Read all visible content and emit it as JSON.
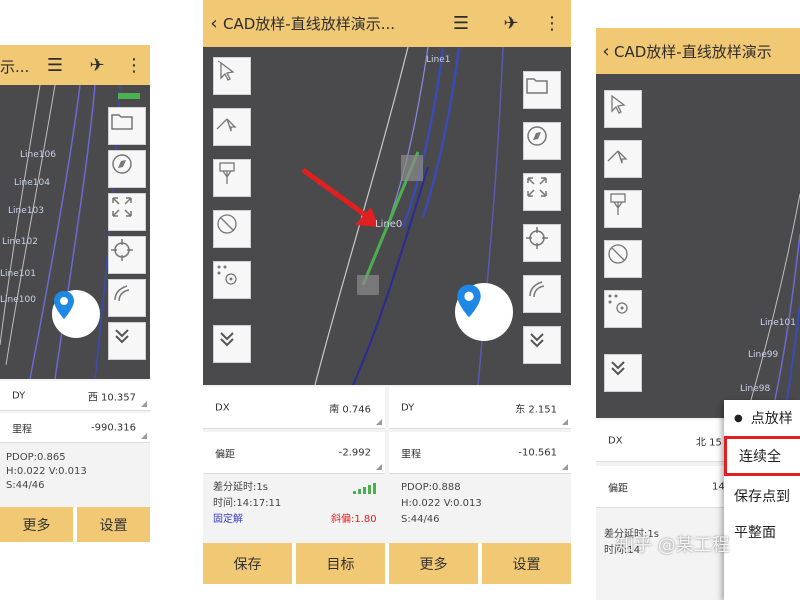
{
  "left": {
    "title": "示...",
    "line_labels": [
      "Line106",
      "Line104",
      "Line103",
      "Line102",
      "Line101",
      "Line100"
    ],
    "fields": [
      {
        "label": "DY",
        "value": "西 10.357"
      },
      {
        "label": "里程",
        "value": "-990.316"
      }
    ],
    "stats": [
      "PDOP:0.865",
      "H:0.022  V:0.013",
      "S:44/46"
    ],
    "buttons": [
      "更多",
      "设置"
    ]
  },
  "center": {
    "title": "CAD放样-直线放样演示...",
    "line_labels": {
      "top": "Line1",
      "mid": "Line0"
    },
    "fields": [
      {
        "label": "DX",
        "value": "南 0.746"
      },
      {
        "label": "DY",
        "value": "东 2.151"
      },
      {
        "label": "偏距",
        "value": "-2.992"
      },
      {
        "label": "里程",
        "value": "-10.561"
      }
    ],
    "status_left": [
      "差分延时:1s",
      "时间:14:17:11",
      "固定解"
    ],
    "status_right": [
      "PDOP:0.888",
      "H:0.022  V:0.013",
      "S:44/46"
    ],
    "offset_value": "斜偏:1.80",
    "buttons": [
      "保存",
      "目标",
      "更多",
      "设置"
    ]
  },
  "right": {
    "title": "CAD放样-直线放样演示",
    "line_labels": [
      "Line101",
      "Line99",
      "Line98"
    ],
    "fields": [
      {
        "label": "DX",
        "value": "北 15"
      },
      {
        "label": "偏距",
        "value": "14"
      }
    ],
    "status": [
      "差分延时:1s",
      "时间:14"
    ],
    "menu_items": [
      "点放样",
      "连续全",
      "保存点到",
      "平整面"
    ],
    "watermark": "知乎 @某工程"
  },
  "colors": {
    "header": "#f1c874",
    "map": "#4a4a4c",
    "accent_red": "#e02020",
    "pin_blue": "#1e88e5",
    "line_blue": "#3a4bb5",
    "line_green": "#4caf50"
  }
}
